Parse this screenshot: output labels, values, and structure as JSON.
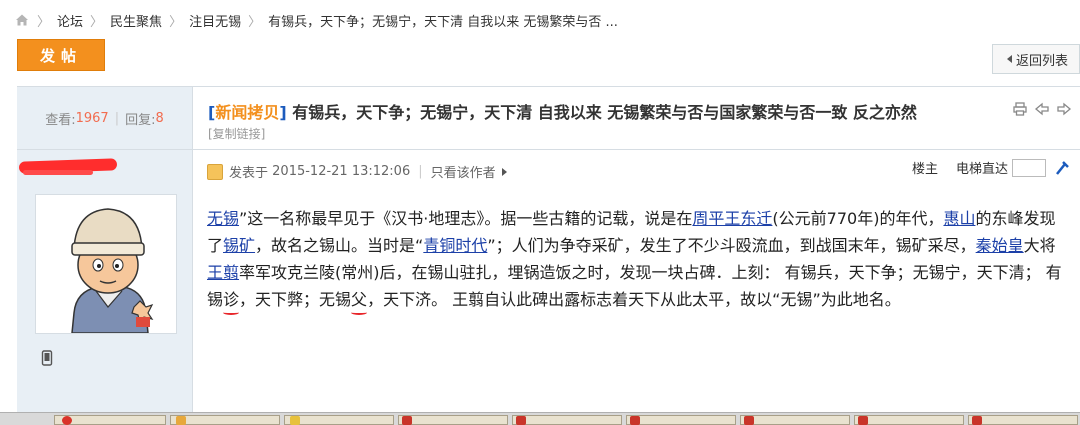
{
  "breadcrumb": {
    "items": [
      "论坛",
      "民生聚焦",
      "注目无锡",
      "有锡兵，天下争；无锡宁，天下清 自我以来 无锡繁荣与否 ..."
    ]
  },
  "toolbar": {
    "post_label": "发帖",
    "back_label": "返回列表"
  },
  "thread": {
    "views_label": "查看:",
    "views": "1967",
    "replies_label": "回复:",
    "replies": "8",
    "tag_open": "[",
    "tag": "新闻拷贝",
    "tag_close": "]",
    "title": "有锡兵，天下争；无锡宁，天下清 自我以来 无锡繁荣与否与国家繁荣与否一致 反之亦然",
    "copy_link": "[复制链接]"
  },
  "post": {
    "posted_prefix": "发表于",
    "posted_at": "2015-12-21 13:12:06",
    "only_author": "只看该作者",
    "floor_label": "楼主",
    "elevator_label": "电梯直达",
    "content": {
      "s1": "无锡",
      "s2": "”这一名称最早见于《汉书·地理志》。据一些古籍的记载，说是在",
      "s3": "周平王东迁",
      "s4": "(公元前770年)的年代，",
      "s5": "惠山",
      "s6": "的东峰发现了",
      "s7": "锡矿",
      "s8": "，故名之锡山。当时是“",
      "s9": "青铜时代",
      "s10": "”；人们为争夺采矿，发生了不少斗殴流血，到战国末年，锡矿采尽，",
      "s11": "秦始皇",
      "s12": "大将",
      "s13": "王翦",
      "s14": "率军攻克兰陵(常州)后，在锡山驻扎，埋锅造饭之时，发现一块占碑．上刻： 有锡兵，天下争；无锡宁，天下清； 有锡",
      "s15": "诊",
      "s16": "，天下弊；无锡",
      "s17": "父",
      "s18": "，天下济。 王翦自认此碑出露标志着天下从此太平，故以“无锡”为此地名。"
    }
  },
  "colors": {
    "accent_orange": "#f3901e",
    "link_blue": "#1c40a8",
    "stat_bg": "#e8eff5",
    "annotation_red": "#e8252a"
  }
}
